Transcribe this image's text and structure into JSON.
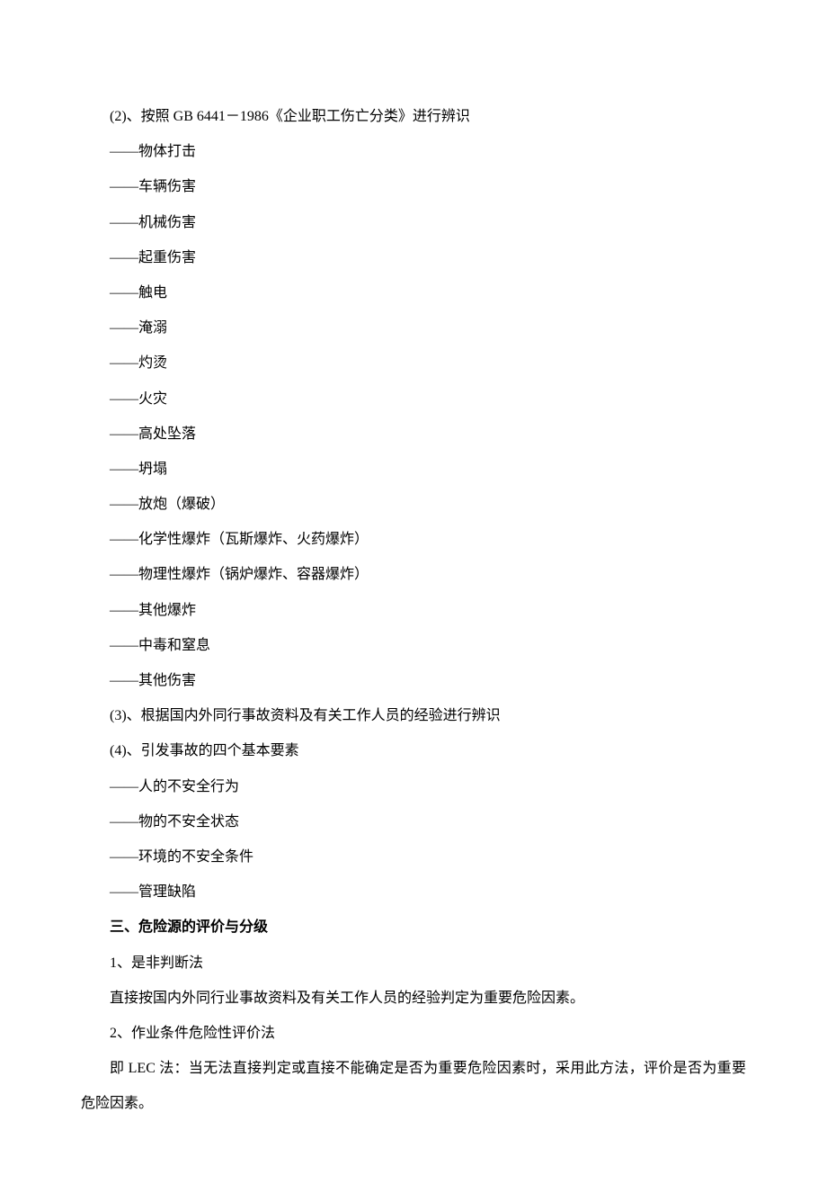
{
  "lines": {
    "l1": "(2)、按照 GB 6441－1986《企业职工伤亡分类》进行辨识",
    "b1": "——物体打击",
    "b2": "——车辆伤害",
    "b3": "——机械伤害",
    "b4": "——起重伤害",
    "b5": "——触电",
    "b6": "——淹溺",
    "b7": "——灼烫",
    "b8": "——火灾",
    "b9": "——高处坠落",
    "b10": "——坍塌",
    "b11": "——放炮（爆破）",
    "b12": "——化学性爆炸（瓦斯爆炸、火药爆炸）",
    "b13": "——物理性爆炸（锅炉爆炸、容器爆炸）",
    "b14": "——其他爆炸",
    "b15": "——中毒和窒息",
    "b16": "——其他伤害",
    "l2": "(3)、根据国内外同行事故资料及有关工作人员的经验进行辨识",
    "l3": "(4)、引发事故的四个基本要素",
    "c1": "——人的不安全行为",
    "c2": "——物的不安全状态",
    "c3": "——环境的不安全条件",
    "c4": "——管理缺陷",
    "h1": "三、危险源的评价与分级",
    "p1": "1、是非判断法",
    "p2": "直接按国内外同行业事故资料及有关工作人员的经验判定为重要危险因素。",
    "p3": "2、作业条件危险性评价法",
    "p4": "即 LEC 法：当无法直接判定或直接不能确定是否为重要危险因素时，采用此方法，评价是否为重要危险因素。"
  }
}
